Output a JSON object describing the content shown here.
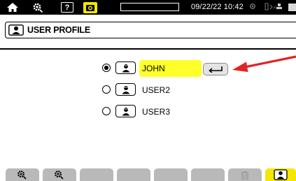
{
  "statusbar": {
    "datetime": "09/22/22 10:42",
    "help_label": "?",
    "progress_percent": 0,
    "icons": [
      "home-icon",
      "settings-icon",
      "help-icon",
      "camera-icon",
      "progress-bar",
      "recording-icon",
      "network-icon",
      "battery-icon"
    ]
  },
  "header": {
    "title": "USER PROFILE"
  },
  "users": [
    {
      "name": "JOHN",
      "selected": true
    },
    {
      "name": "USER2",
      "selected": false
    },
    {
      "name": "USER3",
      "selected": false
    }
  ],
  "bottom_tabs": [
    {
      "icon": "config-gear-icon",
      "active": false
    },
    {
      "icon": "config-gear-2-icon",
      "active": false
    },
    {
      "icon": "",
      "active": false
    },
    {
      "icon": "",
      "active": false
    },
    {
      "icon": "",
      "active": false
    },
    {
      "icon": "",
      "active": false
    },
    {
      "icon": "trash-icon",
      "active": false
    },
    {
      "icon": "user-profile-icon",
      "active": true
    }
  ],
  "colors": {
    "highlight": "#ffff29",
    "active_tab": "#f5e700",
    "tab": "#b9b9b9",
    "arrow": "#e02424",
    "statusbar": "#000000"
  }
}
